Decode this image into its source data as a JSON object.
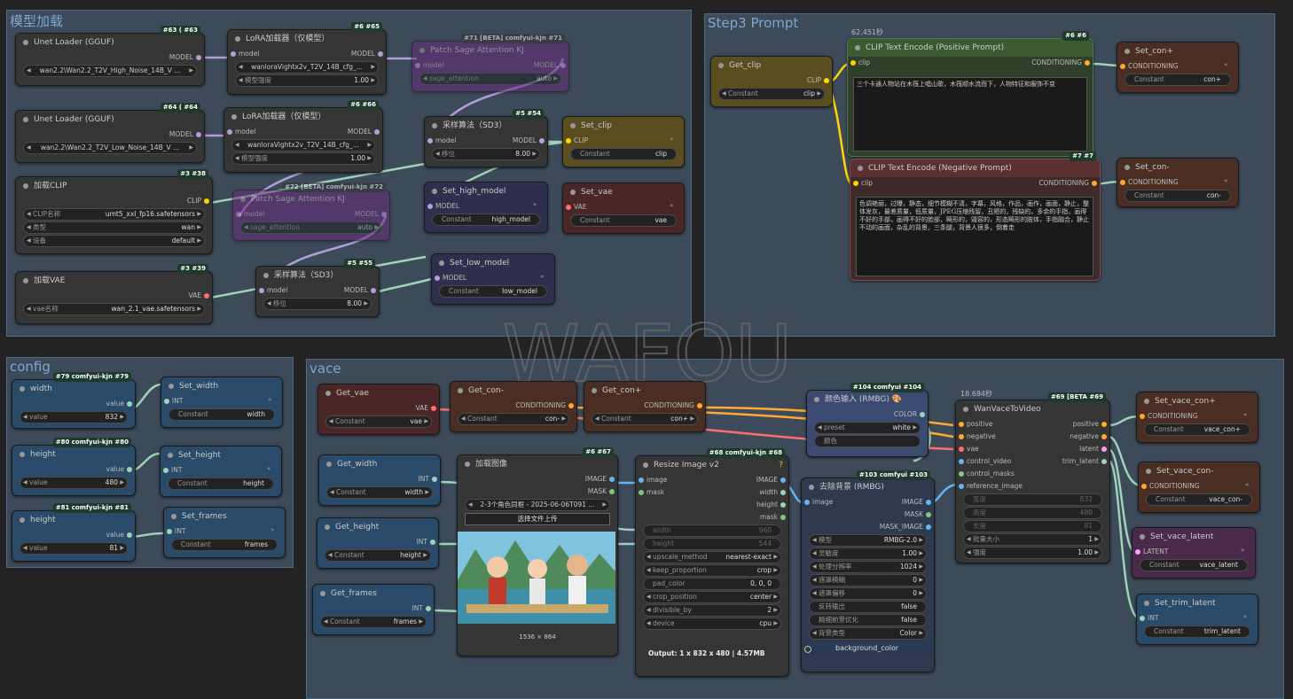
{
  "groups": {
    "model": "模型加载",
    "step3": "Step3 Prompt",
    "config": "config",
    "vace": "vace"
  },
  "watermark": "WAFOU",
  "nodes": {
    "unet1": {
      "title": "Unet Loader (GGUF)",
      "badge": "#63 ( #63",
      "out": "MODEL",
      "value": "wan2.2\\Wan2.2_T2V_High_Noise_14B_V ..."
    },
    "lora1": {
      "title": "LoRA加载器（仅模型）",
      "badge": "#6 #65",
      "in": "model",
      "out": "MODEL",
      "value": "wanloraVightx2v_T2V_14B_cfg_...",
      "strength_label": "模型强度",
      "strength": "1.00"
    },
    "sage1": {
      "title": "Patch Sage Attention KJ",
      "badge": "#71 [BETA] comfyui-kjn #71",
      "in": "model",
      "out": "MODEL",
      "w_label": "sage_attention",
      "w_value": "auto"
    },
    "unet2": {
      "title": "Unet Loader (GGUF)",
      "badge": "#64 ( #64",
      "out": "MODEL",
      "value": "wan2.2\\Wan2.2_T2V_Low_Noise_14B_V ..."
    },
    "lora2": {
      "title": "LoRA加载器（仅模型）",
      "badge": "#6 #66",
      "in": "model",
      "out": "MODEL",
      "value": "wanloraVightx2v_T2V_14B_cfg_...",
      "strength_label": "模型强度",
      "strength": "1.00"
    },
    "clip": {
      "title": "加载CLIP",
      "badge": "#3 #38",
      "out": "CLIP",
      "w1l": "CLIP名称",
      "w1v": "umt5_xxl_fp16.safetensors",
      "w2l": "类型",
      "w2v": "wan",
      "w3l": "设备",
      "w3v": "default"
    },
    "sage2": {
      "title": "Patch Sage Attention KJ",
      "badge": "#72 [BETA] comfyui-kjn #72",
      "in": "model",
      "out": "MODEL",
      "w_label": "sage_attention",
      "w_value": "auto"
    },
    "vae": {
      "title": "加载VAE",
      "badge": "#3 #39",
      "out": "VAE",
      "w1l": "vae名称",
      "w1v": "wan_2.1_vae.safetensors"
    },
    "sd3a": {
      "title": "采样算法（SD3）",
      "badge": "#5 #54",
      "in": "model",
      "out": "MODEL",
      "w_label": "移位",
      "w_value": "8.00"
    },
    "sd3b": {
      "title": "采样算法（SD3）",
      "badge": "#5 #55",
      "in": "model",
      "out": "MODEL",
      "w_label": "移位",
      "w_value": "8.00"
    },
    "setclip": {
      "title": "Set_clip",
      "in": "CLIP",
      "w_label": "Constant",
      "w_value": "clip"
    },
    "sethigh": {
      "title": "Set_high_model",
      "in": "MODEL",
      "w_label": "Constant",
      "w_value": "high_model"
    },
    "setvae": {
      "title": "Set_vae",
      "in": "VAE",
      "w_label": "Constant",
      "w_value": "vae"
    },
    "setlow": {
      "title": "Set_low_model",
      "in": "MODEL",
      "w_label": "Constant",
      "w_value": "low_model"
    },
    "getclip": {
      "title": "Get_clip",
      "out": "CLIP",
      "w_label": "Constant",
      "w_value": "clip"
    },
    "pos": {
      "title": "CLIP Text Encode (Positive Prompt)",
      "badge": "#6 #6",
      "time": "62.451秒",
      "in": "clip",
      "out": "CONDITIONING",
      "text": "三个卡通人物站在木筏上唱山歌，木筏顺水流而下，人物特征和服饰不变"
    },
    "neg": {
      "title": "CLIP Text Encode (Negative Prompt)",
      "badge": "#7 #7",
      "in": "clip",
      "out": "CONDITIONING",
      "text": "色调艳丽，过曝，静态，细节模糊不清，字幕，风格，作品，画作，画面，静止，整体发灰，最差质量，低质量，JPEG压缩残留，丑陋的，残缺的，多余的手指，画得不好的手部，画得不好的脸部，畸形的，毁容的，形态畸形的肢体，手指融合，静止不动的画面，杂乱的背景，三条腿，背景人很多，倒着走"
    },
    "setconp": {
      "title": "Set_con+",
      "in": "CONDITIONING",
      "w_label": "Constant",
      "w_value": "con+"
    },
    "setconm": {
      "title": "Set_con-",
      "in": "CONDITIONING",
      "w_label": "Constant",
      "w_value": "con-"
    },
    "width": {
      "title": "width",
      "badge": "#79 comfyui-kjn #79",
      "out": "value",
      "w_label": "value",
      "w_value": "832"
    },
    "height": {
      "title": "height",
      "badge": "#80 comfyui-kjn #80",
      "out": "value",
      "w_label": "value",
      "w_value": "480"
    },
    "frames": {
      "title": "height",
      "badge": "#81 comfyui-kjn #81",
      "out": "value",
      "w_label": "value",
      "w_value": "81"
    },
    "setwidth": {
      "title": "Set_width",
      "in": "INT",
      "w_label": "Constant",
      "w_value": "width"
    },
    "setheight": {
      "title": "Set_height",
      "in": "INT",
      "w_label": "Constant",
      "w_value": "height"
    },
    "setframes": {
      "title": "Set_frames",
      "in": "INT",
      "w_label": "Constant",
      "w_value": "frames"
    },
    "getvae": {
      "title": "Get_vae",
      "out": "VAE",
      "w_label": "Constant",
      "w_value": "vae"
    },
    "getconm": {
      "title": "Get_con-",
      "out": "CONDITIONING",
      "w_label": "Constant",
      "w_value": "con-"
    },
    "getconp": {
      "title": "Get_con+",
      "out": "CONDITIONING",
      "w_label": "Constant",
      "w_value": "con+"
    },
    "getwidth": {
      "title": "Get_width",
      "out": "INT",
      "w_label": "Constant",
      "w_value": "width"
    },
    "getheight": {
      "title": "Get_height",
      "out": "INT",
      "w_label": "Constant",
      "w_value": "height"
    },
    "getframes": {
      "title": "Get_frames",
      "out": "INT",
      "w_label": "Constant",
      "w_value": "frames"
    },
    "loadimg": {
      "title": "加载图像",
      "badge": "#6 #67",
      "out1": "IMAGE",
      "out2": "MASK",
      "file": "2-3个角色同框 - 2025-06-06T091 ...",
      "upload": "选择文件上传",
      "size": "1536 × 864"
    },
    "resize": {
      "title": "Resize Image v2",
      "badge": "#68 comfyui-kjn #68",
      "in1": "image",
      "in2": "mask",
      "out1": "IMAGE",
      "out2": "width",
      "out3": "height",
      "out4": "mask",
      "rows": [
        [
          "width",
          "960"
        ],
        [
          "height",
          "544"
        ],
        [
          "upscale_method",
          "nearest-exact"
        ],
        [
          "keep_proportion",
          "crop"
        ],
        [
          "pad_color",
          "0, 0, 0"
        ],
        [
          "crop_position",
          "center"
        ],
        [
          "divisible_by",
          "2"
        ],
        [
          "device",
          "cpu"
        ]
      ],
      "output": "Output: 1 x 832 x 480 | 4.57MB"
    },
    "color": {
      "title": "颜色输入 (RMBG) 🎨",
      "badge": "#104 comfyui #104",
      "out": "COLOR",
      "w1l": "preset",
      "w1v": "white",
      "w2": "颜色"
    },
    "rmbg": {
      "title": "去除背景 (RMBG)",
      "badge": "#103 comfyui #103",
      "in": "image",
      "out1": "IMAGE",
      "out2": "MASK",
      "out3": "MASK_IMAGE",
      "rows": [
        [
          "模型",
          "RMBG-2.0"
        ],
        [
          "灵敏度",
          "1.00"
        ],
        [
          "处理分辨率",
          "1024"
        ],
        [
          "遮罩模糊",
          "0"
        ],
        [
          "遮罩偏移",
          "0"
        ],
        [
          "反转输出",
          "false"
        ],
        [
          "精细前景优化",
          "false"
        ],
        [
          "背景类型",
          "Color"
        ]
      ],
      "bg": "background_color"
    },
    "wanvace": {
      "title": "WanVaceToVideo",
      "badge": "#69 [BETA #69",
      "time": "18.684秒",
      "ins": [
        "positive",
        "negative",
        "vae",
        "control_video",
        "control_masks",
        "reference_image"
      ],
      "outs": [
        "positive",
        "negative",
        "latent",
        "trim_latent"
      ],
      "rows": [
        [
          "宽度",
          "832"
        ],
        [
          "高度",
          "480"
        ],
        [
          "长度",
          "81"
        ],
        [
          "批量大小",
          "1"
        ],
        [
          "强度",
          "1.00"
        ]
      ]
    },
    "setvaceconp": {
      "title": "Set_vace_con+",
      "in": "CONDITIONING",
      "w_label": "Constant",
      "w_value": "vace_con+"
    },
    "setvaceconm": {
      "title": "Set_vace_con-",
      "in": "CONDITIONING",
      "w_label": "Constant",
      "w_value": "vace_con-"
    },
    "setvacelatent": {
      "title": "Set_vace_latent",
      "in": "LATENT",
      "w_label": "Constant",
      "w_value": "vace_latent"
    },
    "settrimlatent": {
      "title": "Set_trim_latent",
      "in": "INT",
      "w_label": "Constant",
      "w_value": "trim_latent"
    }
  },
  "colors": {
    "model": "#b39ddb",
    "clip": "#ffd500",
    "vae": "#ff6e6e",
    "cond": "#ffa931",
    "int": "#9fd2b8",
    "image": "#64b5f6",
    "latent": "#ff9cf9",
    "mask": "#81c784"
  }
}
